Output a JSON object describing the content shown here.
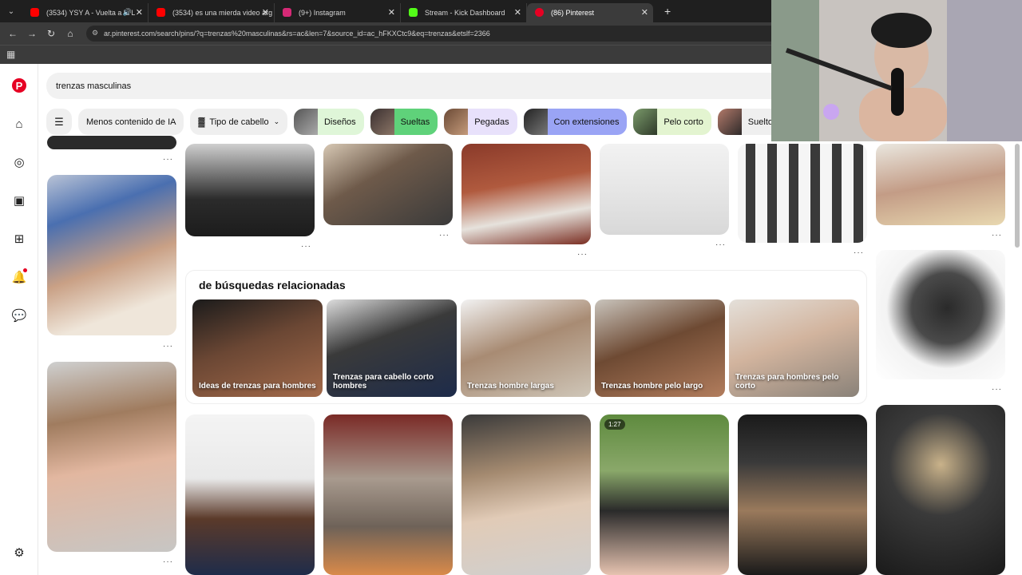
{
  "browser": {
    "tabs": [
      {
        "title": "(3534) YSY A - Vuelta a la L",
        "favicon_color": "#ff0000"
      },
      {
        "title": "(3534) es una mierda video arg",
        "favicon_color": "#ff0000"
      },
      {
        "title": "(9+) Instagram",
        "favicon_color": "#d62976"
      },
      {
        "title": "Stream - Kick Dashboard",
        "favicon_color": "#53fc18"
      },
      {
        "title": "(86) Pinterest",
        "favicon_color": "#e60023"
      }
    ],
    "url": "ar.pinterest.com/search/pins/?q=trenzas%20masculinas&rs=ac&len=7&source_id=ac_hFKXCtc9&eq=trenzas&etslf=2366"
  },
  "search": {
    "query": "trenzas masculinas"
  },
  "chips": [
    "Menos contenido de IA",
    "Tipo de cabello",
    "Diseños",
    "Sueltas",
    "Pegadas",
    "Con extensiones",
    "Pelo corto",
    "Suelto"
  ],
  "chip_colors": {
    "Diseños": "#dff6d8",
    "Sueltas": "#5fd27a",
    "Pegadas": "#e8e1fb",
    "Con extensiones": "#9aa4f5",
    "Pelo corto": "#e3f4d0",
    "Suelto": "#efefef"
  },
  "related": {
    "title": "de búsquedas relacionadas",
    "items": [
      "Ideas de trenzas para hombres",
      "Trenzas para cabello corto hombres",
      "Trenzas hombre largas",
      "Trenzas hombre pelo largo",
      "Trenzas para hombres pelo corto"
    ]
  },
  "video_badge": "1:27",
  "brand_color": "#e60023"
}
